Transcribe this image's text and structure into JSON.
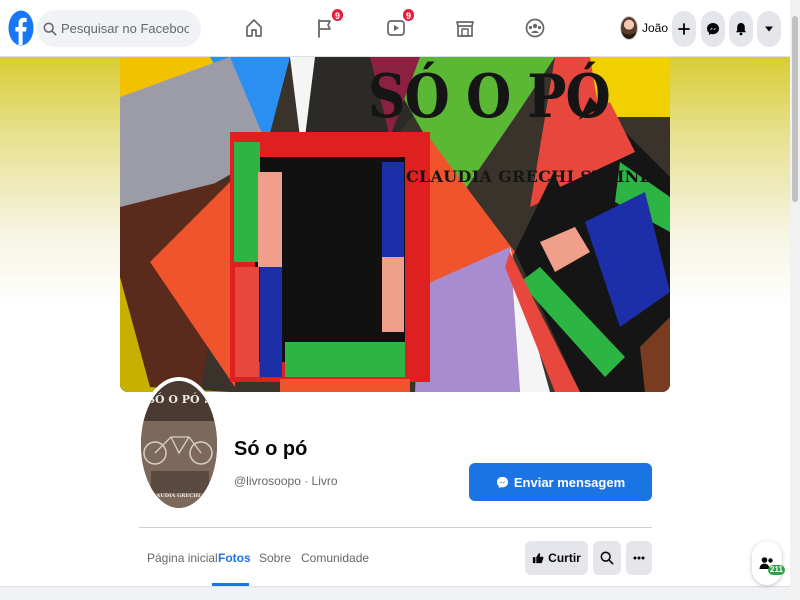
{
  "topbar": {
    "search_placeholder": "Pesquisar no Facebook",
    "nav": [
      {
        "name": "home",
        "badge": ""
      },
      {
        "name": "pages",
        "badge": "9"
      },
      {
        "name": "watch",
        "badge": "9"
      },
      {
        "name": "marketplace",
        "badge": ""
      },
      {
        "name": "groups",
        "badge": ""
      }
    ],
    "profile_name": "João",
    "accent_color": "#1b74e4",
    "badge_color": "#e41e3f"
  },
  "cover": {
    "title": "SÓ O PÓ",
    "author": "CLAUDIA GRECHI STEINER"
  },
  "profile": {
    "pic_title": "SÓ O PÓ !",
    "pic_author": "CLAUDIA GRECHI S",
    "page_name": "Só o pó",
    "handle": "@livrosoopo · Livro",
    "message_button": "Enviar mensagem"
  },
  "tabs": [
    {
      "label": "Página inicial",
      "active": false
    },
    {
      "label": "Fotos",
      "active": true
    },
    {
      "label": "Sobre",
      "active": false
    },
    {
      "label": "Comunidade",
      "active": false
    }
  ],
  "actions": {
    "like_label": "Curtir"
  },
  "contacts": {
    "count": "211"
  }
}
